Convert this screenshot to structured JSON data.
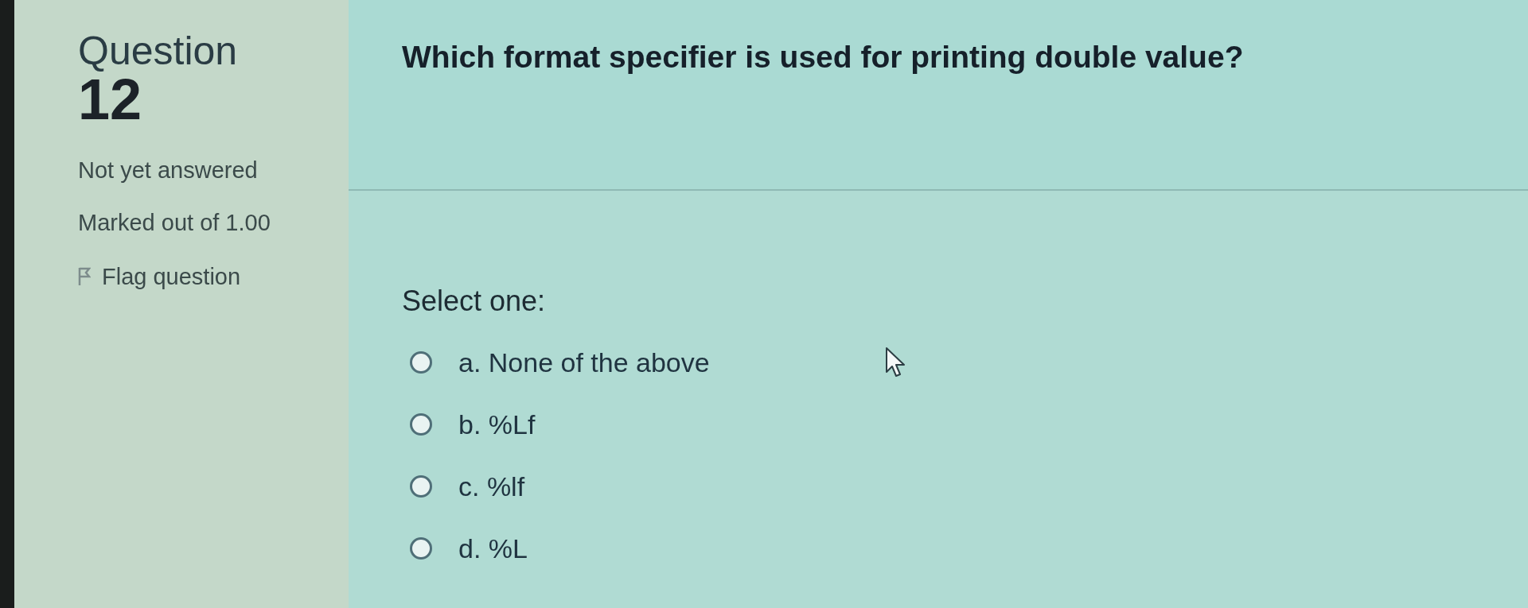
{
  "question_info": {
    "label": "Question",
    "number": "12",
    "status": "Not yet answered",
    "marks": "Marked out of 1.00",
    "flag": {
      "label": "Flag question",
      "flagged": false
    }
  },
  "prompt": "Which format specifier is used for printing double value?",
  "answer": {
    "instruction": "Select one:",
    "options": [
      {
        "label": "a. None of the above",
        "selected": false
      },
      {
        "label": "b. %Lf",
        "selected": false
      },
      {
        "label": "c. %lf",
        "selected": false
      },
      {
        "label": "d. %L",
        "selected": false
      }
    ]
  }
}
